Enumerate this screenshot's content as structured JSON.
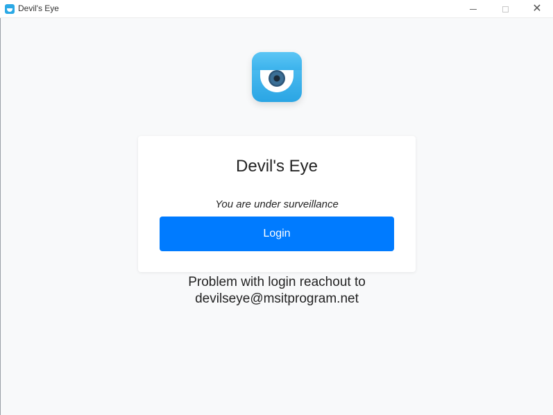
{
  "window": {
    "title": "Devil's Eye",
    "icon": "devils-eye-app-icon",
    "controls": {
      "minimize_icon": "minimize-icon",
      "maximize_icon": "maximize-icon",
      "close_glyph": "✕"
    }
  },
  "logo": {
    "icon": "eye-logo",
    "colors": {
      "background": "#2aa5e4",
      "eye": "#ffffff",
      "iris": "#2e5678"
    }
  },
  "card": {
    "title": "Devil's Eye",
    "subtitle": "You are under surveillance",
    "login_label": "Login"
  },
  "help": {
    "line1": "Problem with login reachout to",
    "line2": "devilseye@msitprogram.net"
  },
  "colors": {
    "accent": "#007bff",
    "background": "#f8f9fa"
  }
}
